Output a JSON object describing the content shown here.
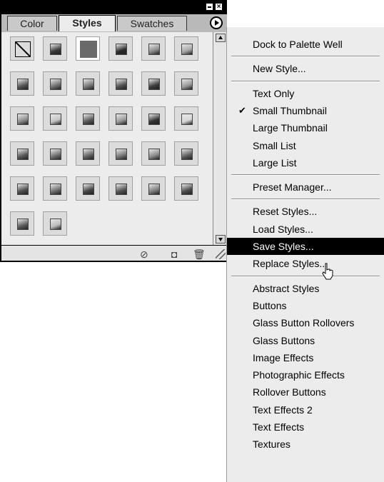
{
  "palette": {
    "tabs": [
      {
        "label": "Color"
      },
      {
        "label": "Styles"
      },
      {
        "label": "Swatches"
      }
    ]
  },
  "menu": {
    "items": [
      {
        "label": "Dock to Palette Well"
      },
      {
        "label": "New Style..."
      },
      {
        "label": "Text Only"
      },
      {
        "label": "Small Thumbnail",
        "checked": true
      },
      {
        "label": "Large Thumbnail"
      },
      {
        "label": "Small List"
      },
      {
        "label": "Large List"
      },
      {
        "label": "Preset Manager..."
      },
      {
        "label": "Reset Styles..."
      },
      {
        "label": "Load Styles..."
      },
      {
        "label": "Save Styles...",
        "highlighted": true
      },
      {
        "label": "Replace Styles..."
      },
      {
        "label": "Abstract Styles"
      },
      {
        "label": "Buttons"
      },
      {
        "label": "Glass Button Rollovers"
      },
      {
        "label": "Glass Buttons"
      },
      {
        "label": "Image Effects"
      },
      {
        "label": "Photographic Effects"
      },
      {
        "label": "Rollover Buttons"
      },
      {
        "label": "Text Effects 2"
      },
      {
        "label": "Text Effects"
      },
      {
        "label": "Textures"
      }
    ],
    "check_glyph": "✔"
  },
  "styles": [
    {
      "name": "none-style-icon",
      "color": "#ffffff"
    },
    {
      "name": "inner-bevel-dark",
      "color": "#3a3a3a"
    },
    {
      "name": "solid-gray",
      "color": "#6a6a6a"
    },
    {
      "name": "round-glow",
      "color": "#2a2a2a"
    },
    {
      "name": "silver-plate",
      "color": "#8a8a8a"
    },
    {
      "name": "light-gray",
      "color": "#a8a8a8"
    },
    {
      "name": "dark-stone",
      "color": "#555555"
    },
    {
      "name": "medium-gray",
      "color": "#707070"
    },
    {
      "name": "gradient-gray",
      "color": "#7a7a7a"
    },
    {
      "name": "brick-pattern",
      "color": "#505050"
    },
    {
      "name": "diagonal-stripes",
      "color": "#3c3c3c"
    },
    {
      "name": "scroll-shape",
      "color": "#999999"
    },
    {
      "name": "sky-gradient",
      "color": "#8c8c8c"
    },
    {
      "name": "pale-bar",
      "color": "#c4c4c4"
    },
    {
      "name": "rounded-button",
      "color": "#595959"
    },
    {
      "name": "noise-texture",
      "color": "#9a9a9a"
    },
    {
      "name": "shadow-box",
      "color": "#333333"
    },
    {
      "name": "white-bar",
      "color": "#d8d8d8"
    },
    {
      "name": "chrome-1",
      "color": "#5a5a5a"
    },
    {
      "name": "chrome-2",
      "color": "#707070"
    },
    {
      "name": "chrome-3",
      "color": "#626262"
    },
    {
      "name": "chrome-4",
      "color": "#787878"
    },
    {
      "name": "chrome-5",
      "color": "#8a8a8a"
    },
    {
      "name": "chrome-6",
      "color": "#5e5e5e"
    },
    {
      "name": "metal-1",
      "color": "#4e4e4e"
    },
    {
      "name": "metal-2",
      "color": "#6e6e6e"
    },
    {
      "name": "metal-3",
      "color": "#444444"
    },
    {
      "name": "metal-4",
      "color": "#555555"
    },
    {
      "name": "metal-5",
      "color": "#7e7e7e"
    },
    {
      "name": "metal-6",
      "color": "#4a4a4a"
    },
    {
      "name": "chrome-7",
      "color": "#5c5c5c"
    },
    {
      "name": "silver-disc",
      "color": "#bbbbbb"
    }
  ]
}
